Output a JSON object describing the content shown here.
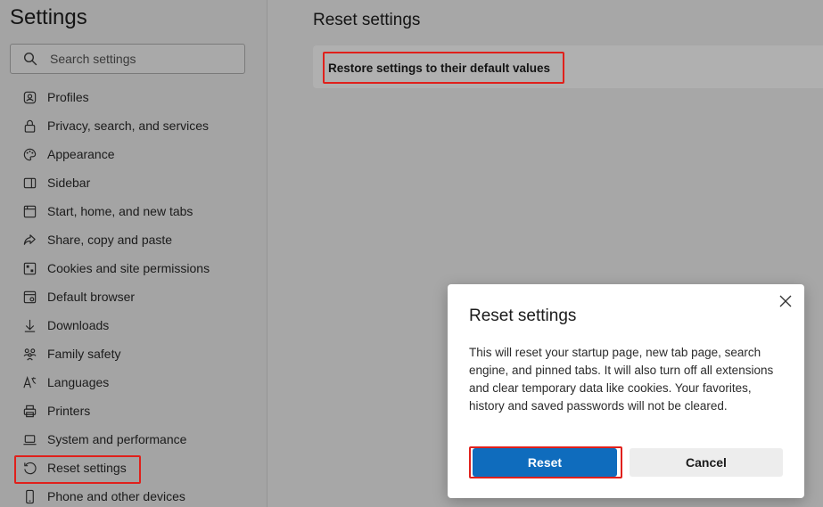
{
  "sidebar": {
    "title": "Settings",
    "search_placeholder": "Search settings",
    "items": [
      {
        "label": "Profiles",
        "icon": "profile-icon"
      },
      {
        "label": "Privacy, search, and services",
        "icon": "lock-icon"
      },
      {
        "label": "Appearance",
        "icon": "palette-icon"
      },
      {
        "label": "Sidebar",
        "icon": "sidebar-icon"
      },
      {
        "label": "Start, home, and new tabs",
        "icon": "home-tabs-icon"
      },
      {
        "label": "Share, copy and paste",
        "icon": "share-icon"
      },
      {
        "label": "Cookies and site permissions",
        "icon": "cookies-icon"
      },
      {
        "label": "Default browser",
        "icon": "browser-icon"
      },
      {
        "label": "Downloads",
        "icon": "download-icon"
      },
      {
        "label": "Family safety",
        "icon": "family-icon"
      },
      {
        "label": "Languages",
        "icon": "language-icon"
      },
      {
        "label": "Printers",
        "icon": "printer-icon"
      },
      {
        "label": "System and performance",
        "icon": "laptop-icon"
      },
      {
        "label": "Reset settings",
        "icon": "reset-icon",
        "active": true
      },
      {
        "label": "Phone and other devices",
        "icon": "phone-icon"
      }
    ]
  },
  "main": {
    "title": "Reset settings",
    "card_label": "Restore settings to their default values"
  },
  "dialog": {
    "title": "Reset settings",
    "body": "This will reset your startup page, new tab page, search engine, and pinned tabs. It will also turn off all extensions and clear temporary data like cookies. Your favorites, history and saved passwords will not be cleared.",
    "reset_label": "Reset",
    "cancel_label": "Cancel"
  },
  "colors": {
    "accent": "#0f6cbd",
    "highlight": "#e0201b"
  }
}
